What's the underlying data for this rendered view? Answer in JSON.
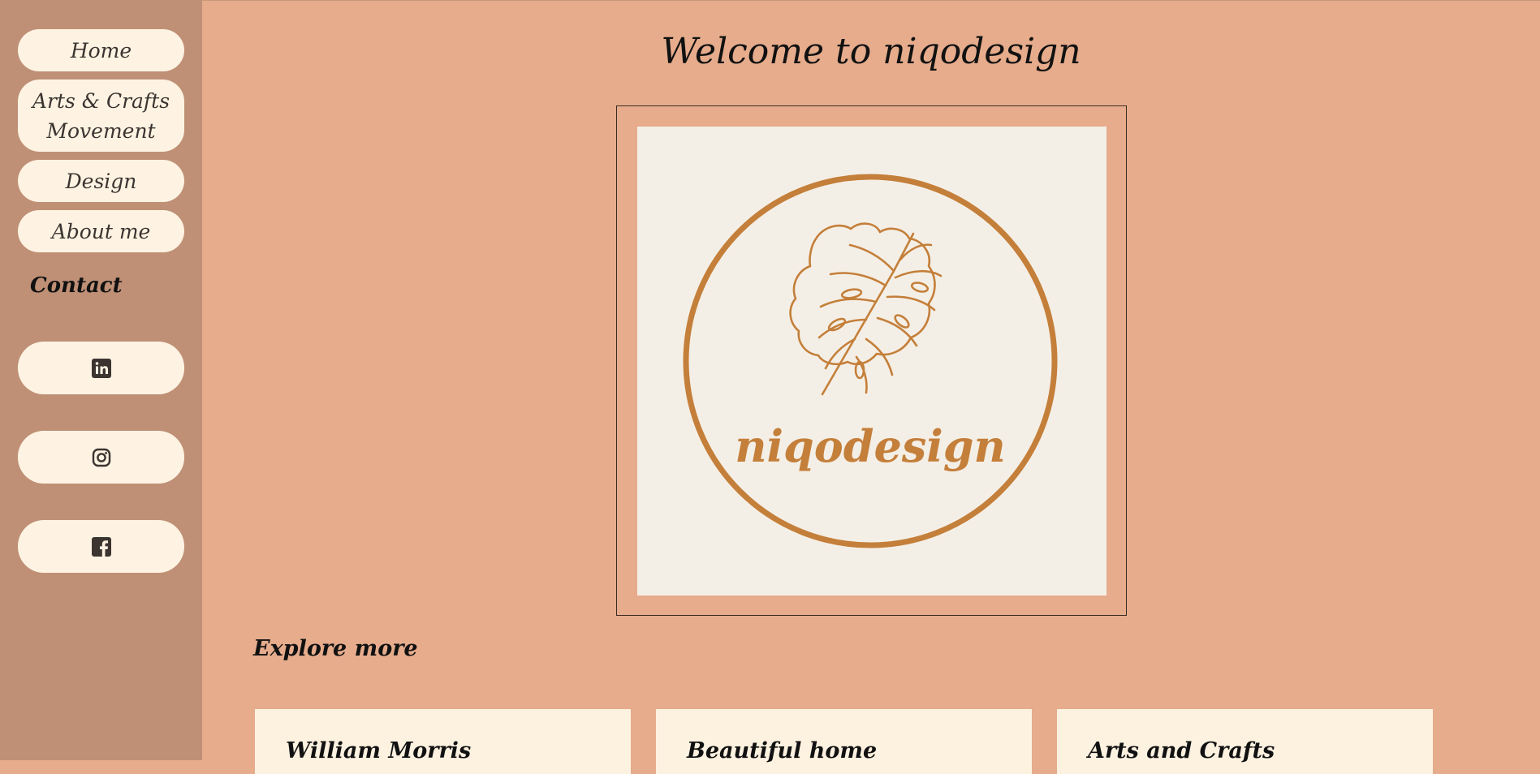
{
  "sidebar": {
    "nav": [
      {
        "label": "Home"
      },
      {
        "label": "Arts & Crafts Movement"
      },
      {
        "label": "Design"
      },
      {
        "label": "About me"
      }
    ],
    "contact_heading": "Contact",
    "social": [
      {
        "icon": "linkedin-icon"
      },
      {
        "icon": "instagram-icon"
      },
      {
        "icon": "facebook-icon"
      }
    ]
  },
  "main": {
    "title": "Welcome to niqodesign",
    "logo": {
      "text": "niqodesign",
      "color": "#c47f3a"
    },
    "explore_heading": "Explore more",
    "cards": [
      {
        "title": "William Morris"
      },
      {
        "title": "Beautiful home"
      },
      {
        "title": "Arts and Crafts"
      }
    ]
  },
  "colors": {
    "page_bg": "#e6ac8c",
    "sidebar_bg": "#bf9076",
    "button_bg": "#fef3e2",
    "accent": "#c47f3a"
  }
}
